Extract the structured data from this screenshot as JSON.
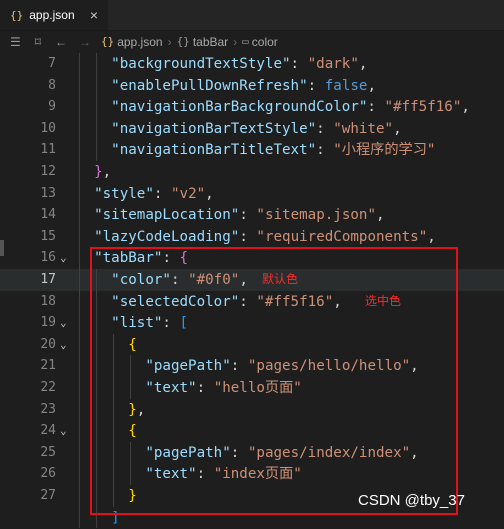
{
  "tab": {
    "icon": "{}",
    "title": "app.json",
    "close": "×"
  },
  "breadcrumb": {
    "items": [
      "app.json",
      "tabBar",
      "color"
    ],
    "json_icon": "{}",
    "obj_icon": "{}",
    "prop_icon": "▭"
  },
  "lines": [
    {
      "n": "7",
      "tokens": [
        [
          "    ",
          "p"
        ],
        [
          "\"backgroundTextStyle\"",
          "k"
        ],
        [
          ": ",
          "p"
        ],
        [
          "\"dark\"",
          "s"
        ],
        [
          ",",
          "p"
        ]
      ]
    },
    {
      "n": "8",
      "tokens": [
        [
          "    ",
          "p"
        ],
        [
          "\"enablePullDownRefresh\"",
          "k"
        ],
        [
          ": ",
          "p"
        ],
        [
          "false",
          "b"
        ],
        [
          ",",
          "p"
        ]
      ]
    },
    {
      "n": "9",
      "tokens": [
        [
          "    ",
          "p"
        ],
        [
          "\"navigationBarBackgroundColor\"",
          "k"
        ],
        [
          ": ",
          "p"
        ],
        [
          "\"#ff5f16\"",
          "s"
        ],
        [
          ",",
          "p"
        ]
      ]
    },
    {
      "n": "10",
      "tokens": [
        [
          "    ",
          "p"
        ],
        [
          "\"navigationBarTextStyle\"",
          "k"
        ],
        [
          ": ",
          "p"
        ],
        [
          "\"white\"",
          "s"
        ],
        [
          ",",
          "p"
        ]
      ]
    },
    {
      "n": "11",
      "tokens": [
        [
          "    ",
          "p"
        ],
        [
          "\"navigationBarTitleText\"",
          "k"
        ],
        [
          ": ",
          "p"
        ],
        [
          "\"小程序的学习\"",
          "s"
        ]
      ]
    },
    {
      "n": "12",
      "tokens": [
        [
          "  ",
          "p"
        ],
        [
          "}",
          "br2"
        ],
        [
          ",",
          "p"
        ]
      ]
    },
    {
      "n": "13",
      "tokens": [
        [
          "  ",
          "p"
        ],
        [
          "\"style\"",
          "k"
        ],
        [
          ": ",
          "p"
        ],
        [
          "\"v2\"",
          "s"
        ],
        [
          ",",
          "p"
        ]
      ]
    },
    {
      "n": "14",
      "tokens": [
        [
          "  ",
          "p"
        ],
        [
          "\"sitemapLocation\"",
          "k"
        ],
        [
          ": ",
          "p"
        ],
        [
          "\"sitemap.json\"",
          "s"
        ],
        [
          ",",
          "p"
        ]
      ]
    },
    {
      "n": "15",
      "tokens": [
        [
          "  ",
          "p"
        ],
        [
          "\"lazyCodeLoading\"",
          "k"
        ],
        [
          ": ",
          "p"
        ],
        [
          "\"requiredComponents\"",
          "s"
        ],
        [
          ",",
          "p"
        ]
      ]
    },
    {
      "n": "16",
      "fold": "⌄",
      "tokens": [
        [
          "  ",
          "p"
        ],
        [
          "\"tabBar\"",
          "k"
        ],
        [
          ": ",
          "p"
        ],
        [
          "{",
          "br2"
        ]
      ]
    },
    {
      "n": "17",
      "current": true,
      "tokens": [
        [
          "    ",
          "p"
        ],
        [
          "\"color\"",
          "k"
        ],
        [
          ": ",
          "p"
        ],
        [
          "\"#0f0\"",
          "s"
        ],
        [
          ",",
          "p"
        ]
      ]
    },
    {
      "n": "18",
      "tokens": [
        [
          "    ",
          "p"
        ],
        [
          "\"selectedColor\"",
          "k"
        ],
        [
          ": ",
          "p"
        ],
        [
          "\"#ff5f16\"",
          "s"
        ],
        [
          ",",
          "p"
        ]
      ]
    },
    {
      "n": "19",
      "fold": "⌄",
      "tokens": [
        [
          "    ",
          "p"
        ],
        [
          "\"list\"",
          "k"
        ],
        [
          ": ",
          "p"
        ],
        [
          "[",
          "br3"
        ]
      ]
    },
    {
      "n": "20",
      "fold": "⌄",
      "tokens": [
        [
          "      ",
          "p"
        ],
        [
          "{",
          "br1"
        ]
      ]
    },
    {
      "n": "21",
      "tokens": [
        [
          "        ",
          "p"
        ],
        [
          "\"pagePath\"",
          "k"
        ],
        [
          ": ",
          "p"
        ],
        [
          "\"pages/hello/hello\"",
          "s"
        ],
        [
          ",",
          "p"
        ]
      ]
    },
    {
      "n": "22",
      "tokens": [
        [
          "        ",
          "p"
        ],
        [
          "\"text\"",
          "k"
        ],
        [
          ": ",
          "p"
        ],
        [
          "\"hello页面\"",
          "s"
        ]
      ]
    },
    {
      "n": "23",
      "tokens": [
        [
          "      ",
          "p"
        ],
        [
          "}",
          "br1"
        ],
        [
          ",",
          "p"
        ]
      ]
    },
    {
      "n": "24",
      "fold": "⌄",
      "tokens": [
        [
          "      ",
          "p"
        ],
        [
          "{",
          "br1"
        ]
      ]
    },
    {
      "n": "25",
      "tokens": [
        [
          "        ",
          "p"
        ],
        [
          "\"pagePath\"",
          "k"
        ],
        [
          ": ",
          "p"
        ],
        [
          "\"pages/index/index\"",
          "s"
        ],
        [
          ",",
          "p"
        ]
      ]
    },
    {
      "n": "26",
      "tokens": [
        [
          "        ",
          "p"
        ],
        [
          "\"text\"",
          "k"
        ],
        [
          ": ",
          "p"
        ],
        [
          "\"index页面\"",
          "s"
        ]
      ]
    },
    {
      "n": "27",
      "tokens": [
        [
          "      ",
          "p"
        ],
        [
          "}",
          "br1"
        ]
      ]
    },
    {
      "n": "",
      "tokens": [
        [
          "    ",
          "p"
        ],
        [
          "]",
          "br3"
        ]
      ]
    }
  ],
  "annotations": {
    "default_color": "默认色",
    "selected_color": "选中色"
  },
  "watermark": "CSDN @tby_37"
}
